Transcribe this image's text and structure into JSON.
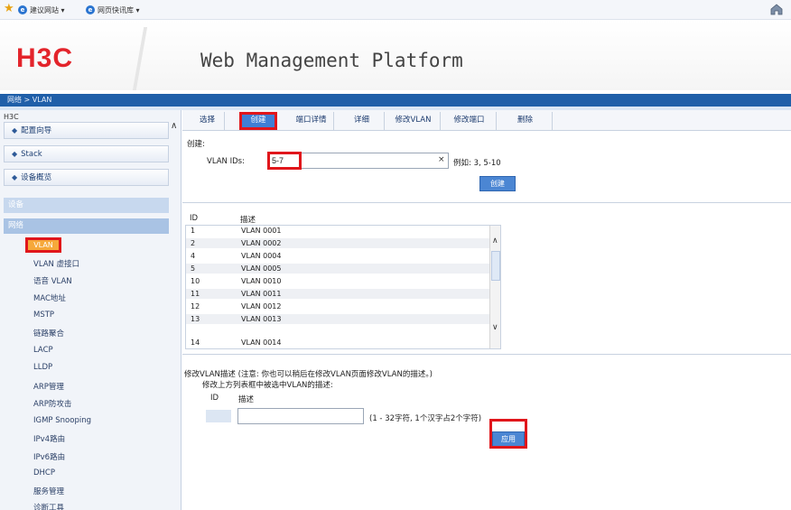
{
  "favorites_bar": {
    "items": [
      "建议网站 ▾",
      "网页快讯库 ▾"
    ],
    "icons": [
      "favorites-star-icon",
      "ie-page-icon",
      "home-icon"
    ]
  },
  "header": {
    "logo": "H3C",
    "title": "Web Management Platform",
    "breadcrumb": "网络 > VLAN"
  },
  "sidebar": {
    "root": "H3C",
    "nav_buttons": [
      "配置向导",
      "Stack",
      "设备概览"
    ],
    "sections": [
      "设备",
      "网络"
    ],
    "items": [
      "VLAN",
      "VLAN 虚接口",
      "语音 VLAN",
      "MAC地址",
      "MSTP",
      "链路聚合",
      "LACP",
      "LLDP",
      "ARP管理",
      "ARP防攻击",
      "IGMP Snooping",
      "IPv4路由",
      "IPv6路由",
      "DHCP",
      "服务管理",
      "诊断工具"
    ],
    "active_item": "VLAN"
  },
  "tabs": [
    "选择",
    "创建",
    "端口详情",
    "详细",
    "修改VLAN",
    "修改端口",
    "删除"
  ],
  "active_tab": "创建",
  "create_form": {
    "section_label": "创建:",
    "vlan_ids_label": "VLAN IDs:",
    "vlan_ids_value": "5-7",
    "clear_glyph": "×",
    "example_text": "例如: 3, 5-10",
    "create_button": "创建"
  },
  "vlan_table": {
    "columns": [
      "ID",
      "描述"
    ],
    "rows": [
      {
        "id": "1",
        "desc": "VLAN 0001"
      },
      {
        "id": "2",
        "desc": "VLAN 0002"
      },
      {
        "id": "4",
        "desc": "VLAN 0004"
      },
      {
        "id": "5",
        "desc": "VLAN 0005"
      },
      {
        "id": "10",
        "desc": "VLAN 0010"
      },
      {
        "id": "11",
        "desc": "VLAN 0011"
      },
      {
        "id": "12",
        "desc": "VLAN 0012"
      },
      {
        "id": "13",
        "desc": "VLAN 0013"
      },
      {
        "id": "14",
        "desc": "VLAN 0014"
      }
    ]
  },
  "modify_form": {
    "title": "修改VLAN描述 (注意: 你也可以稍后在修改VLAN页面修改VLAN的描述。)",
    "subtitle": "修改上方列表框中被选中VLAN的描述:",
    "col_id": "ID",
    "col_desc": "描述",
    "desc_value": "",
    "hint": "(1 - 32字符, 1个汉字占2个字符)",
    "apply_button": "应用"
  },
  "colors": {
    "brand_red": "#e3242b",
    "highlight_red": "#e0161b",
    "nav_blue": "#1f5fa9",
    "button_blue": "#4b86d3",
    "active_orange": "#f6a83a"
  }
}
